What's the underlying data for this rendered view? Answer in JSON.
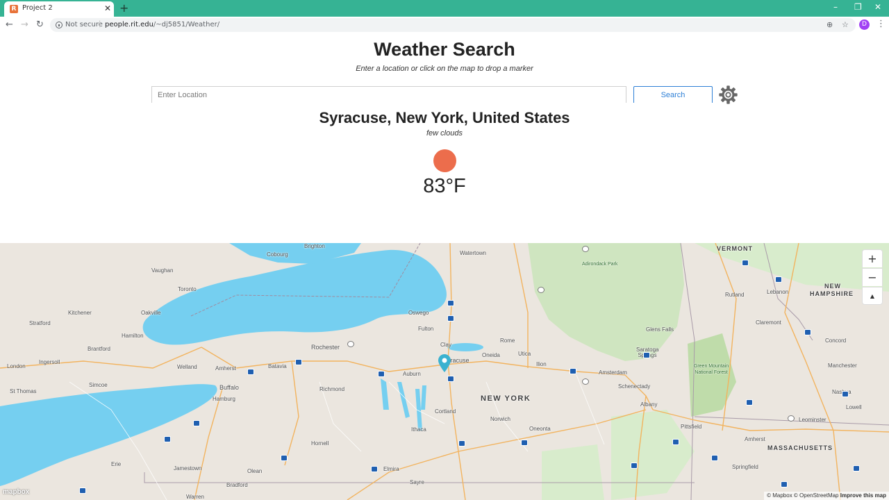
{
  "browser": {
    "tab_title": "Project 2",
    "tab_favicon_letter": "R",
    "security_label": "Not secure",
    "url_host": "people.rit.edu",
    "url_path": "/~dj5851/Weather/"
  },
  "page": {
    "title": "Weather Search",
    "subtitle": "Enter a location or click on the map to drop a marker"
  },
  "search": {
    "placeholder": "Enter Location",
    "value": "",
    "button_label": "Search"
  },
  "weather": {
    "location": "Syracuse, New York, United States",
    "conditions": "few clouds",
    "temperature": "83°F",
    "icon_color": "#ec6d4c"
  },
  "map": {
    "zoom_in": "+",
    "zoom_out": "−",
    "reset_north": "▲",
    "logo": "mapbox",
    "attribution": "© Mapbox © OpenStreetMap",
    "improve_link": "Improve this map",
    "states": [
      "NEW YORK",
      "VERMONT",
      "NEW",
      "HAMPSHIRE",
      "MASSACHUSETTS"
    ],
    "parks": [
      "Adirondack Park",
      "Green Mountain National Forest"
    ],
    "cities": [
      "Toronto",
      "Oakville",
      "Hamilton",
      "Kitchener",
      "Vaughan",
      "Cobourg",
      "Brighton",
      "Stratford",
      "Brantford",
      "London",
      "Ingersoll",
      "Simcoe",
      "St Thomas",
      "Welland",
      "Amherst",
      "Buffalo",
      "Hamburg",
      "Batavia",
      "Rochester",
      "Richmond",
      "Auburn",
      "Oswego",
      "Fulton",
      "Clay",
      "Syracuse",
      "Oneida",
      "Rome",
      "Utica",
      "Ilion",
      "Amsterdam",
      "Saratoga Springs",
      "Glens Falls",
      "Schenectady",
      "Albany",
      "Watertown",
      "Cortland",
      "Norwich",
      "Oneonta",
      "Ithaca",
      "Hornell",
      "Elmira",
      "Olean",
      "Jamestown",
      "Erie",
      "Bradford",
      "Sayre",
      "Warren",
      "Pittsfield",
      "Springfield",
      "Rutland",
      "Lebanon",
      "Claremont",
      "Concord",
      "Manchester",
      "Nashua",
      "Lowell",
      "Leominster",
      "Amherst"
    ],
    "colors": {
      "water": "#75cff0",
      "land": "#ebe6df",
      "park": "#cfe5c0",
      "road": "#f2b35e",
      "marker": "#3bb2d0"
    }
  }
}
